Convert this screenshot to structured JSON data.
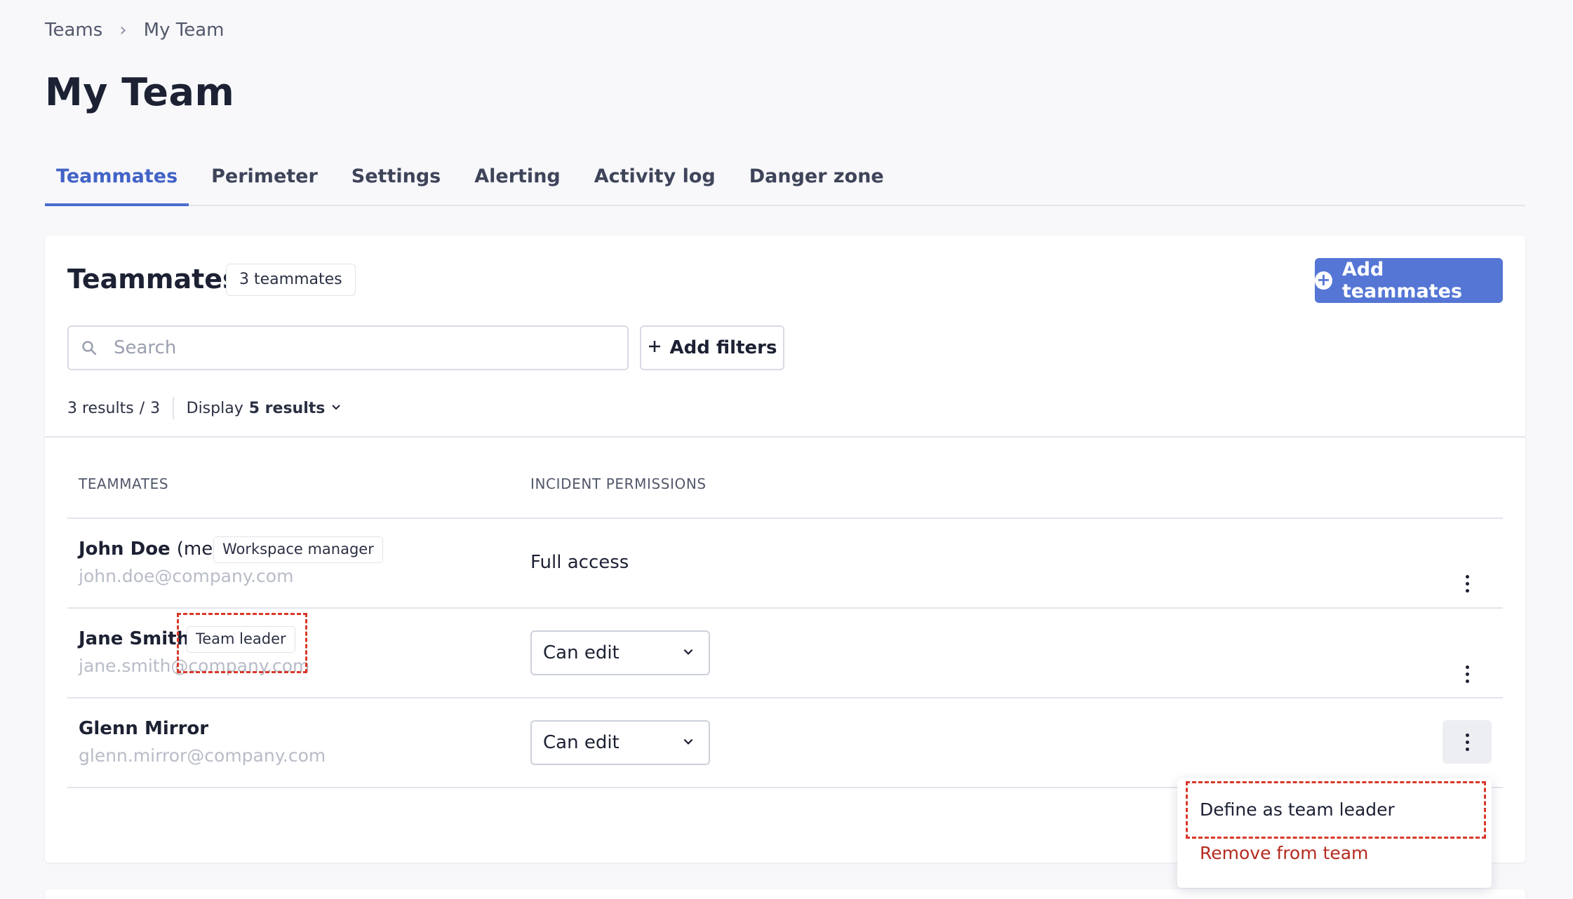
{
  "breadcrumb": {
    "parent": "Teams",
    "current": "My Team"
  },
  "page": {
    "title": "My Team"
  },
  "tabs": [
    {
      "label": "Teammates"
    },
    {
      "label": "Perimeter"
    },
    {
      "label": "Settings"
    },
    {
      "label": "Alerting"
    },
    {
      "label": "Activity log"
    },
    {
      "label": "Danger zone"
    }
  ],
  "teammates_section": {
    "title": "Teammates",
    "count_badge": "3 teammates",
    "add_button_label": "Add teammates",
    "search_placeholder": "Search",
    "add_filters_label": "Add filters",
    "results_count": "3 results",
    "results_total": "3",
    "display_label": "Display",
    "display_value": "5 results"
  },
  "table": {
    "columns": [
      "TEAMMATES",
      "INCIDENT PERMISSIONS"
    ],
    "rows": [
      {
        "name": "John Doe",
        "suffix": "(me)",
        "tag": "Workspace manager",
        "email": "john.doe@company.com",
        "permission": "Full access"
      },
      {
        "name": "Jane Smith",
        "tag": "Team leader",
        "email": "jane.smith@company.com",
        "permission": "Can edit"
      },
      {
        "name": "Glenn Mirror",
        "email": "glenn.mirror@company.com",
        "permission": "Can edit"
      }
    ]
  },
  "context_menu": {
    "items": [
      "Define as team leader",
      "Remove from team"
    ]
  },
  "colors": {
    "accent": "#4263c6",
    "primary_button": "#5576d5",
    "danger_text": "#b52a1f",
    "highlight_dashed": "#d9382a"
  }
}
